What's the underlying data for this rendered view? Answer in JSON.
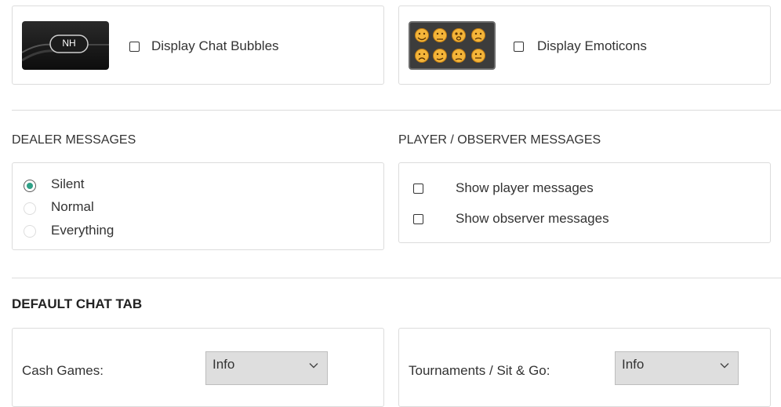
{
  "display": {
    "chat_bubbles": {
      "badge": "NH",
      "label": "Display Chat Bubbles",
      "checked": false
    },
    "emoticons": {
      "label": "Display Emoticons",
      "checked": false
    }
  },
  "dealer_messages": {
    "title": "DEALER MESSAGES",
    "options": [
      {
        "label": "Silent",
        "selected": true
      },
      {
        "label": "Normal",
        "selected": false
      },
      {
        "label": "Everything",
        "selected": false
      }
    ]
  },
  "player_observer_messages": {
    "title": "PLAYER / OBSERVER MESSAGES",
    "items": [
      {
        "label": "Show player messages",
        "checked": false
      },
      {
        "label": "Show observer messages",
        "checked": false
      }
    ]
  },
  "default_chat_tab": {
    "title": "DEFAULT CHAT TAB",
    "cash_games": {
      "label": "Cash Games:",
      "value": "Info"
    },
    "tournaments": {
      "label": "Tournaments / Sit & Go:",
      "value": "Info"
    }
  },
  "colors": {
    "radio_accent": "#2fa187",
    "border": "#dcdcdc",
    "select_bg": "#dedede"
  }
}
